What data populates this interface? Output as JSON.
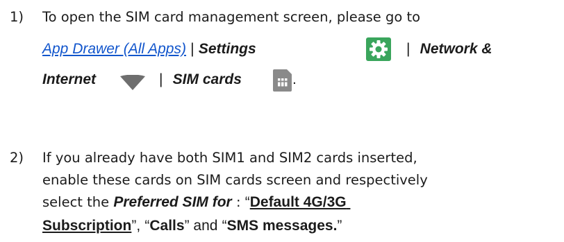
{
  "step1": {
    "number": "1)",
    "intro": "To open the SIM card management screen, please go to",
    "app_drawer": "App Drawer (All Apps)",
    "sep1": "|",
    "settings": "Settings",
    "sep2": "|",
    "network": "Network &",
    "internet": "Internet",
    "sep3": "|",
    "sim_cards": "SIM cards",
    "period": "."
  },
  "step2": {
    "number": "2)",
    "line1": "If you already have both SIM1 and SIM2 cards inserted,",
    "line2": "enable these cards on SIM cards screen and respectively",
    "line3_prefix": "select the",
    "preferred": "Preferred SIM for",
    "colon": ":",
    "quote_open1": "“",
    "default_sub_part1": "Default 4G/3G",
    "default_sub_part2": "Subscription",
    "quote_close1": "”,",
    "quote_open2": "“",
    "calls": "Calls",
    "quote_close2": "” and",
    "quote_open3": "“",
    "sms": "SMS messages.",
    "quote_close3": "”"
  },
  "icons": {
    "settings_icon": "gear-icon",
    "network_icon": "wifi-icon",
    "sim_icon": "sim-card-icon",
    "settings_bg": "#3aa55c",
    "network_color": "#6e6e6e",
    "sim_color": "#8a8a8a"
  }
}
